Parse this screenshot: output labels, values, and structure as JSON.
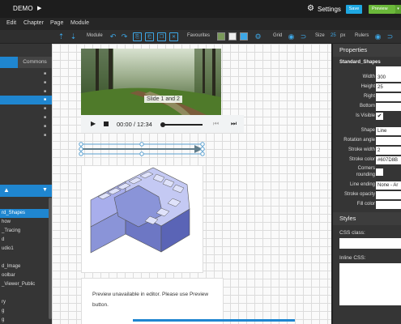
{
  "titlebar": {
    "project_name": "DEMO",
    "settings_label": "Settings",
    "save_label": "Save",
    "preview_label": "Preview"
  },
  "menubar": {
    "items": [
      "Edit",
      "Chapter",
      "Page",
      "Module"
    ]
  },
  "toolbar": {
    "module_label": "Module",
    "favourites_label": "Favourites",
    "grid_label": "Grid",
    "size_label": "Size",
    "size_value": "25",
    "size_unit": "px",
    "rulers_label": "Rulers"
  },
  "left_panel": {
    "tab_commons": "Commons",
    "modules": [
      "rd_Shapes",
      "how",
      "_Tracing",
      "d",
      "udio1",
      "d_Image",
      "oolbar",
      "_Viewer_Public",
      "ry",
      "g",
      "g"
    ]
  },
  "canvas": {
    "slideshow_caption": "Slide 1 and 2",
    "audio_time": "00:00 / 12:34",
    "web_message": "Preview unavailable in editor. Please use Preview button."
  },
  "properties": {
    "header": "Properties",
    "module_name": "Standard_Shapes",
    "top_value": "",
    "width_label": "Width",
    "width_value": "300",
    "height_label": "Height",
    "height_value": "25",
    "right_label": "Right",
    "bottom_label": "Bottom",
    "is_visible_label": "Is Visible",
    "shape_label": "Shape",
    "shape_value": "Line",
    "rotation_label": "Rotation angle",
    "stroke_width_label": "Stroke width",
    "stroke_width_value": "2",
    "stroke_color_label": "Stroke color",
    "stroke_color_value": "#607D8B",
    "corners_label_1": "Corners",
    "corners_label_2": "rounding",
    "line_ending_label": "Line ending",
    "line_ending_value": "None - Ar",
    "stroke_opacity_label": "Stroke opacity",
    "fill_color_label": "Fill color"
  },
  "styles": {
    "header": "Styles",
    "css_class_label": "CSS class:",
    "inline_css_label": "Inline CSS:"
  },
  "colors": {
    "accent_blue": "#1f86d0",
    "save_button": "#1ea7e1",
    "preview_button": "#6bb83a",
    "shape_fill": "#8a94d8"
  }
}
